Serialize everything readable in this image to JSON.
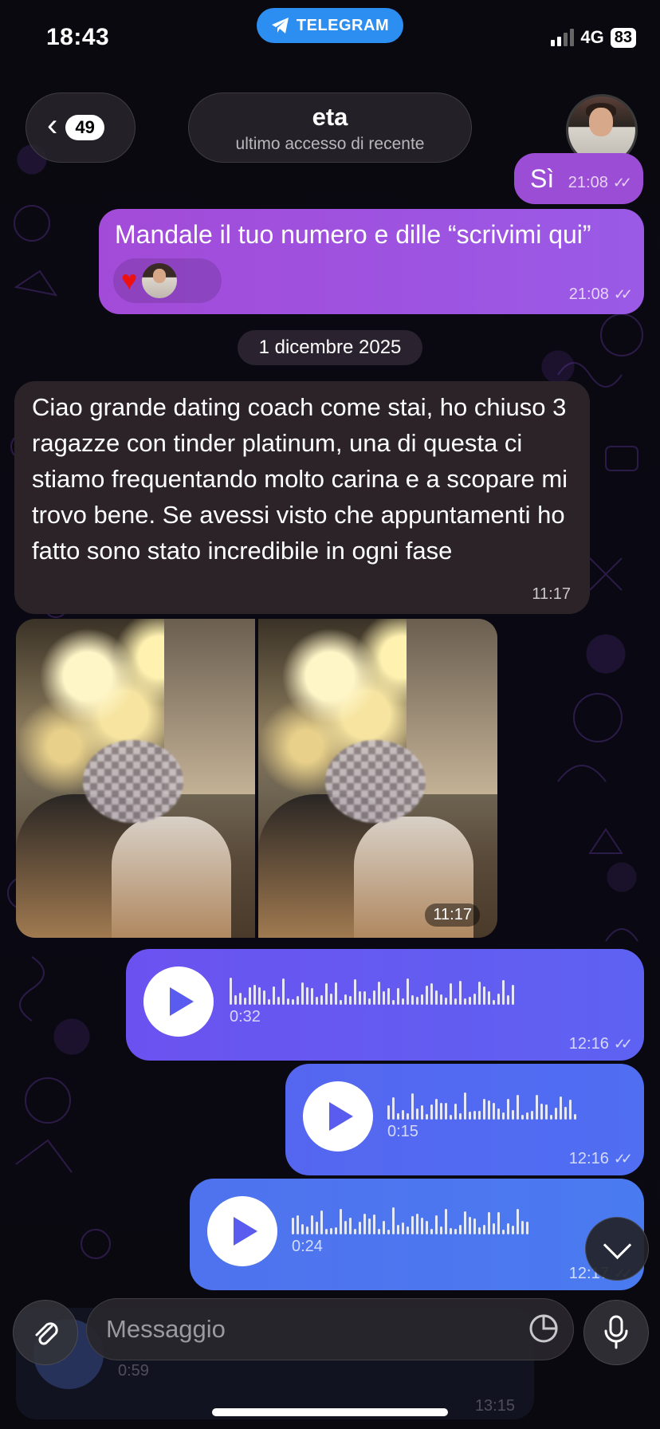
{
  "status_bar": {
    "time": "18:43",
    "app_pill": "TELEGRAM",
    "network": "4G",
    "battery": "83"
  },
  "header": {
    "back_count": "49",
    "name": "eta",
    "subtitle": "ultimo accesso di recente"
  },
  "messages": {
    "si": {
      "text": "Sì",
      "time": "21:08"
    },
    "mandale": {
      "text": "Mandale il tuo numero e dille “scrivimi qui”",
      "time": "21:08"
    },
    "date_separator": "1 dicembre 2025",
    "ciao": {
      "text": "Ciao grande dating coach come stai, ho chiuso 3 ragazze con tinder platinum, una di questa ci stiamo frequentando molto carina e a scopare mi trovo bene. Se avessi visto che appuntamenti ho fatto sono stato incredibile in ogni fase",
      "time": "11:17"
    },
    "photos": {
      "time": "11:17"
    },
    "voice1": {
      "duration": "0:32",
      "time": "12:16"
    },
    "voice2": {
      "duration": "0:15",
      "time": "12:16"
    },
    "voice3": {
      "duration": "0:24",
      "time": "12:17"
    },
    "ghost_voice": {
      "duration": "0:59",
      "time": "13:15"
    }
  },
  "composer": {
    "placeholder": "Messaggio"
  },
  "icons": {
    "back": "chevron-left-icon",
    "attach": "paperclip-icon",
    "sticker": "sticker-icon",
    "mic": "microphone-icon",
    "play": "play-icon",
    "scroll": "chevron-down-icon",
    "telegram": "telegram-plane-icon",
    "heart": "heart-icon"
  },
  "colors": {
    "outgoing": "#9c4dd5",
    "incoming": "#2b2328",
    "voice": "#5e62f2",
    "telegram": "#2b8ef0"
  }
}
